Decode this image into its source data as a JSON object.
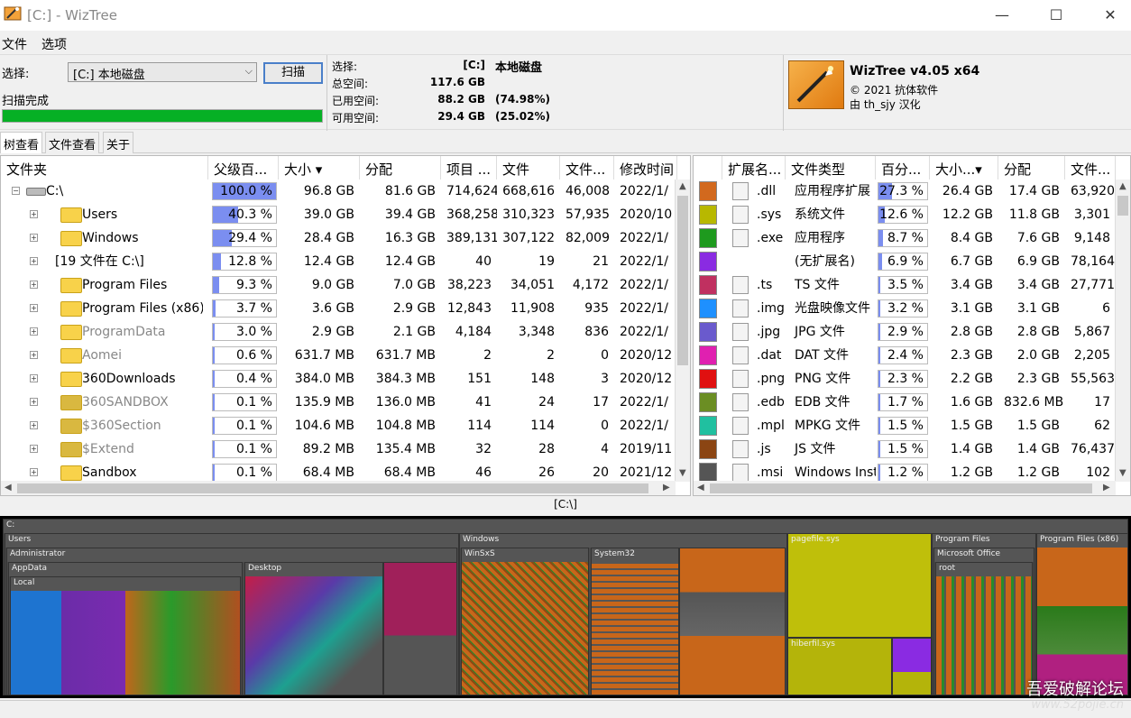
{
  "window": {
    "title": "[C:]  - WizTree",
    "minimize": "—",
    "maximize": "☐",
    "close": "✕"
  },
  "menu": [
    "文件",
    "选项"
  ],
  "select_label": "选择:",
  "drive_value": "[C:] 本地磁盘",
  "scan_button": "扫描",
  "scan_status": "扫描完成",
  "scan_progress": 1.0,
  "disk": {
    "select_key": "选择:",
    "select_val": "[C:]",
    "select_name": "本地磁盘",
    "total_key": "总空间:",
    "total_val": "117.6 GB",
    "used_key": "已用空间:",
    "used_val": "88.2 GB",
    "used_pct": "(74.98%)",
    "free_key": "可用空间:",
    "free_val": "29.4 GB",
    "free_pct": "(25.02%)"
  },
  "brand": {
    "name": "WizTree v4.05 x64",
    "copyright": "© 2021 抗体软件",
    "translator": "由 th_sjy 汉化"
  },
  "tabs": [
    "树查看",
    "文件查看",
    "关于"
  ],
  "tree": {
    "headers": [
      "文件夹",
      "父级百...",
      "大小 ▾",
      "分配",
      "项目 ...",
      "文件",
      "文件...",
      "修改时间"
    ],
    "rows": [
      {
        "name": "C:\\",
        "pct": "100.0 %",
        "pctv": 1.0,
        "size": "96.8 GB",
        "alloc": "81.6 GB",
        "items": "714,624",
        "files": "668,616",
        "folders": "46,008",
        "mtime": "2022/1/",
        "icon": "drive",
        "indent": 0,
        "grey": false
      },
      {
        "name": "Users",
        "pct": "40.3 %",
        "pctv": 0.403,
        "size": "39.0 GB",
        "alloc": "39.4 GB",
        "items": "368,258",
        "files": "310,323",
        "folders": "57,935",
        "mtime": "2020/10",
        "icon": "folder",
        "indent": 1,
        "grey": false
      },
      {
        "name": "Windows",
        "pct": "29.4 %",
        "pctv": 0.294,
        "size": "28.4 GB",
        "alloc": "16.3 GB",
        "items": "389,131",
        "files": "307,122",
        "folders": "82,009",
        "mtime": "2022/1/",
        "icon": "folder",
        "indent": 1,
        "grey": false
      },
      {
        "name": "[19 文件在          C:\\]",
        "pct": "12.8 %",
        "pctv": 0.128,
        "size": "12.4 GB",
        "alloc": "12.4 GB",
        "items": "40",
        "files": "19",
        "folders": "21",
        "mtime": "2022/1/",
        "icon": "none",
        "indent": 1,
        "grey": false
      },
      {
        "name": "Program Files",
        "pct": "9.3 %",
        "pctv": 0.093,
        "size": "9.0 GB",
        "alloc": "7.0 GB",
        "items": "38,223",
        "files": "34,051",
        "folders": "4,172",
        "mtime": "2022/1/",
        "icon": "folder",
        "indent": 1,
        "grey": false
      },
      {
        "name": "Program Files (x86)",
        "pct": "3.7 %",
        "pctv": 0.037,
        "size": "3.6 GB",
        "alloc": "2.9 GB",
        "items": "12,843",
        "files": "11,908",
        "folders": "935",
        "mtime": "2022/1/",
        "icon": "folder",
        "indent": 1,
        "grey": false
      },
      {
        "name": "ProgramData",
        "pct": "3.0 %",
        "pctv": 0.03,
        "size": "2.9 GB",
        "alloc": "2.1 GB",
        "items": "4,184",
        "files": "3,348",
        "folders": "836",
        "mtime": "2022/1/",
        "icon": "folder",
        "indent": 1,
        "grey": true
      },
      {
        "name": "Aomei",
        "pct": "0.6 %",
        "pctv": 0.006,
        "size": "631.7 MB",
        "alloc": "631.7 MB",
        "items": "2",
        "files": "2",
        "folders": "0",
        "mtime": "2020/12",
        "icon": "folder",
        "indent": 1,
        "grey": true
      },
      {
        "name": "360Downloads",
        "pct": "0.4 %",
        "pctv": 0.004,
        "size": "384.0 MB",
        "alloc": "384.3 MB",
        "items": "151",
        "files": "148",
        "folders": "3",
        "mtime": "2020/12",
        "icon": "folder",
        "indent": 1,
        "grey": false
      },
      {
        "name": "360SANDBOX",
        "pct": "0.1 %",
        "pctv": 0.001,
        "size": "135.9 MB",
        "alloc": "136.0 MB",
        "items": "41",
        "files": "24",
        "folders": "17",
        "mtime": "2022/1/",
        "icon": "gear",
        "indent": 1,
        "grey": true
      },
      {
        "name": "$360Section",
        "pct": "0.1 %",
        "pctv": 0.001,
        "size": "104.6 MB",
        "alloc": "104.8 MB",
        "items": "114",
        "files": "114",
        "folders": "0",
        "mtime": "2022/1/",
        "icon": "gear",
        "indent": 1,
        "grey": true
      },
      {
        "name": "$Extend",
        "pct": "0.1 %",
        "pctv": 0.001,
        "size": "89.2 MB",
        "alloc": "135.4 MB",
        "items": "32",
        "files": "28",
        "folders": "4",
        "mtime": "2019/11",
        "icon": "gear",
        "indent": 1,
        "grey": true
      },
      {
        "name": "Sandbox",
        "pct": "0.1 %",
        "pctv": 0.001,
        "size": "68.4 MB",
        "alloc": "68.4 MB",
        "items": "46",
        "files": "26",
        "folders": "20",
        "mtime": "2021/12",
        "icon": "folder",
        "indent": 1,
        "grey": false
      }
    ]
  },
  "ext": {
    "headers": [
      "",
      "扩展名...",
      "文件类型",
      "百分...",
      "大小...▾",
      "分配",
      "文件..."
    ],
    "rows": [
      {
        "color": "#d2691e",
        "ext": ".dll",
        "type": "应用程序扩展",
        "pct": "27.3 %",
        "pctv": 0.273,
        "size": "26.4 GB",
        "alloc": "17.4 GB",
        "files": "63,920"
      },
      {
        "color": "#b8b800",
        "ext": ".sys",
        "type": "系统文件",
        "pct": "12.6 %",
        "pctv": 0.126,
        "size": "12.2 GB",
        "alloc": "11.8 GB",
        "files": "3,301"
      },
      {
        "color": "#1e9a1e",
        "ext": ".exe",
        "type": "应用程序",
        "pct": "8.7 %",
        "pctv": 0.087,
        "size": "8.4 GB",
        "alloc": "7.6 GB",
        "files": "9,148"
      },
      {
        "color": "#8a2be2",
        "ext": "",
        "type": "(无扩展名)",
        "pct": "6.9 %",
        "pctv": 0.069,
        "size": "6.7 GB",
        "alloc": "6.9 GB",
        "files": "78,164"
      },
      {
        "color": "#c03060",
        "ext": ".ts",
        "type": "TS 文件",
        "pct": "3.5 %",
        "pctv": 0.035,
        "size": "3.4 GB",
        "alloc": "3.4 GB",
        "files": "27,771"
      },
      {
        "color": "#1e90ff",
        "ext": ".img",
        "type": "光盘映像文件",
        "pct": "3.2 %",
        "pctv": 0.032,
        "size": "3.1 GB",
        "alloc": "3.1 GB",
        "files": "6"
      },
      {
        "color": "#6a5acd",
        "ext": ".jpg",
        "type": "JPG 文件",
        "pct": "2.9 %",
        "pctv": 0.029,
        "size": "2.8 GB",
        "alloc": "2.8 GB",
        "files": "5,867"
      },
      {
        "color": "#e020b0",
        "ext": ".dat",
        "type": "DAT 文件",
        "pct": "2.4 %",
        "pctv": 0.024,
        "size": "2.3 GB",
        "alloc": "2.0 GB",
        "files": "2,205"
      },
      {
        "color": "#e01010",
        "ext": ".png",
        "type": "PNG 文件",
        "pct": "2.3 %",
        "pctv": 0.023,
        "size": "2.2 GB",
        "alloc": "2.3 GB",
        "files": "55,563"
      },
      {
        "color": "#6b8e23",
        "ext": ".edb",
        "type": "EDB 文件",
        "pct": "1.7 %",
        "pctv": 0.017,
        "size": "1.6 GB",
        "alloc": "832.6 MB",
        "files": "17"
      },
      {
        "color": "#20c0a0",
        "ext": ".mpl",
        "type": "MPKG 文件",
        "pct": "1.5 %",
        "pctv": 0.015,
        "size": "1.5 GB",
        "alloc": "1.5 GB",
        "files": "62"
      },
      {
        "color": "#8b4513",
        "ext": ".js",
        "type": "JS 文件",
        "pct": "1.5 %",
        "pctv": 0.015,
        "size": "1.4 GB",
        "alloc": "1.4 GB",
        "files": "76,437"
      },
      {
        "color": "#555555",
        "ext": ".msi",
        "type": "Windows Inst",
        "pct": "1.2 %",
        "pctv": 0.012,
        "size": "1.2 GB",
        "alloc": "1.2 GB",
        "files": "102"
      }
    ]
  },
  "path_label": "[C:\\]",
  "treemap": {
    "root": "C:",
    "labels": {
      "users": "Users",
      "admin": "Administrator",
      "appdata": "AppData",
      "local": "Local",
      "desktop": "Desktop",
      "windows": "Windows",
      "winsxs": "WinSxS",
      "system32": "System32",
      "pagefile": "pagefile.sys",
      "hiberfil": "hiberfil.sys",
      "pf": "Program Files",
      "office": "Microsoft Office",
      "root": "root",
      "pf86": "Program Files (x86)"
    }
  },
  "watermark": {
    "line1": "吾爱破解论坛",
    "line2": "www.52pojie.cn"
  }
}
